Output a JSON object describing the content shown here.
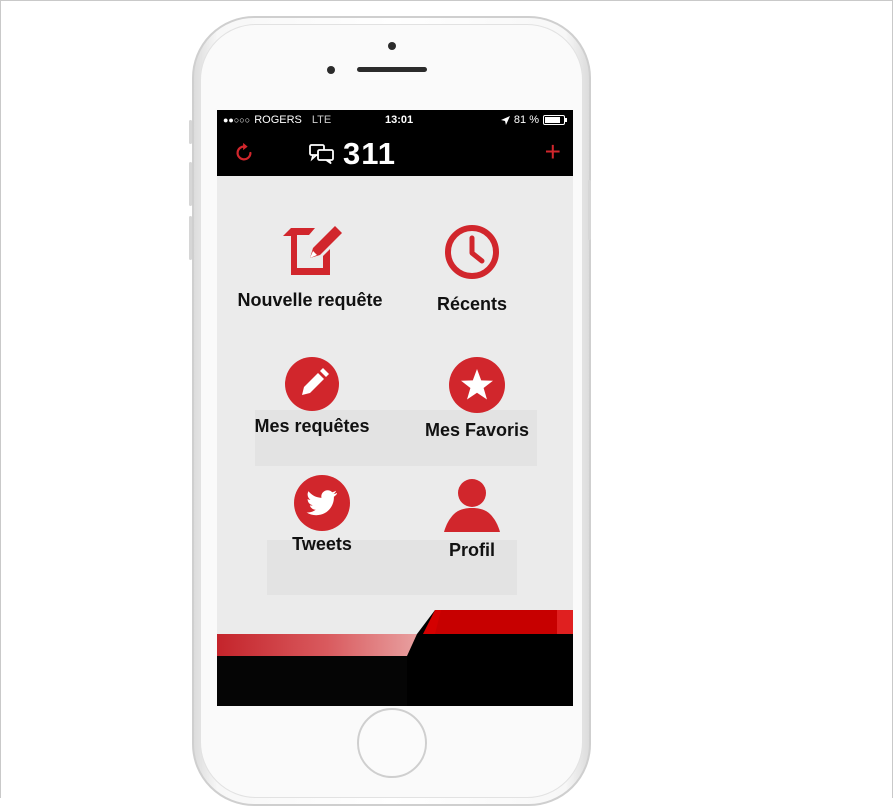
{
  "statusbar": {
    "carrier": "ROGERS",
    "network": "LTE",
    "time": "13:01",
    "battery": "81 %",
    "battery_level": 0.81,
    "signal_dots": "●●○○○"
  },
  "navbar": {
    "title": "311",
    "refresh_icon": "refresh-icon",
    "chat_icon": "chat-bubbles-icon",
    "add_label": "+"
  },
  "menu": {
    "new_request": "Nouvelle requête",
    "recent": "Récents",
    "my_requests": "Mes requêtes",
    "favorites": "Mes Favoris",
    "tweets": "Tweets",
    "profile": "Profil"
  },
  "colors": {
    "accent": "#d1262c",
    "bar": "#000000",
    "screen_bg": "#ebebeb"
  }
}
